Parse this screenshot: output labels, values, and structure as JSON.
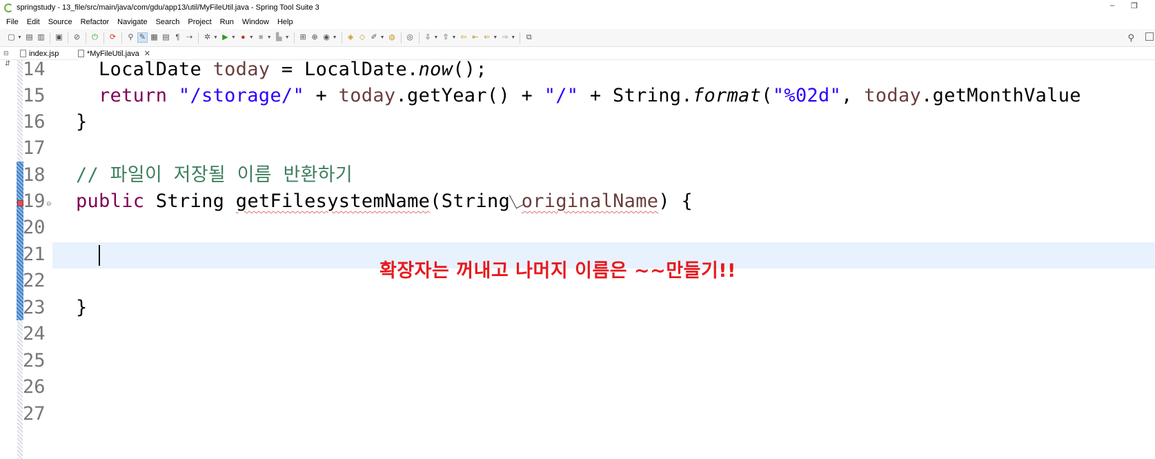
{
  "window": {
    "title": "springstudy - 13_file/src/main/java/com/gdu/app13/util/MyFileUtil.java - Spring Tool Suite 3",
    "minimize": "–",
    "restore": "❐"
  },
  "menu": [
    "File",
    "Edit",
    "Source",
    "Refactor",
    "Navigate",
    "Search",
    "Project",
    "Run",
    "Window",
    "Help"
  ],
  "toolbar": {
    "search_icon": "search-icon"
  },
  "tabs": [
    {
      "label": "index.jsp",
      "icon": "jsp-file-icon",
      "active": false
    },
    {
      "label": "*MyFileUtil.java",
      "icon": "java-file-icon",
      "active": true,
      "close": "✕"
    }
  ],
  "editor": {
    "line_numbers": [
      "14",
      "15",
      "16",
      "17",
      "18",
      "19",
      "20",
      "21",
      "22",
      "23",
      "24",
      "25",
      "26",
      "27"
    ],
    "lines": {
      "l14": {
        "a": "LocalDate ",
        "b": "today",
        "c": " = LocalDate.",
        "d": "now",
        "e": "();"
      },
      "l15": {
        "a": "return ",
        "b": "\"/storage/\"",
        "c": " + ",
        "d": "today",
        "e": ".getYear() + ",
        "f": "\"/\"",
        "g": " + String.",
        "h": "format",
        "i": "(",
        "j": "\"%02d\"",
        "k": ", ",
        "l": "today",
        "m": ".getMonthValue"
      },
      "l16": "}",
      "l18": "// 파일이 저장될 이름 반환하기",
      "l19": {
        "a": "public ",
        "b": "String ",
        "c": "getFilesystemName",
        "d": "(String ",
        "e": "originalName",
        "f": ") {"
      },
      "l23": "}"
    },
    "current_line": "21"
  },
  "annotation": "확장자는 꺼내고 나머지 이름은 ~~만들기!!"
}
